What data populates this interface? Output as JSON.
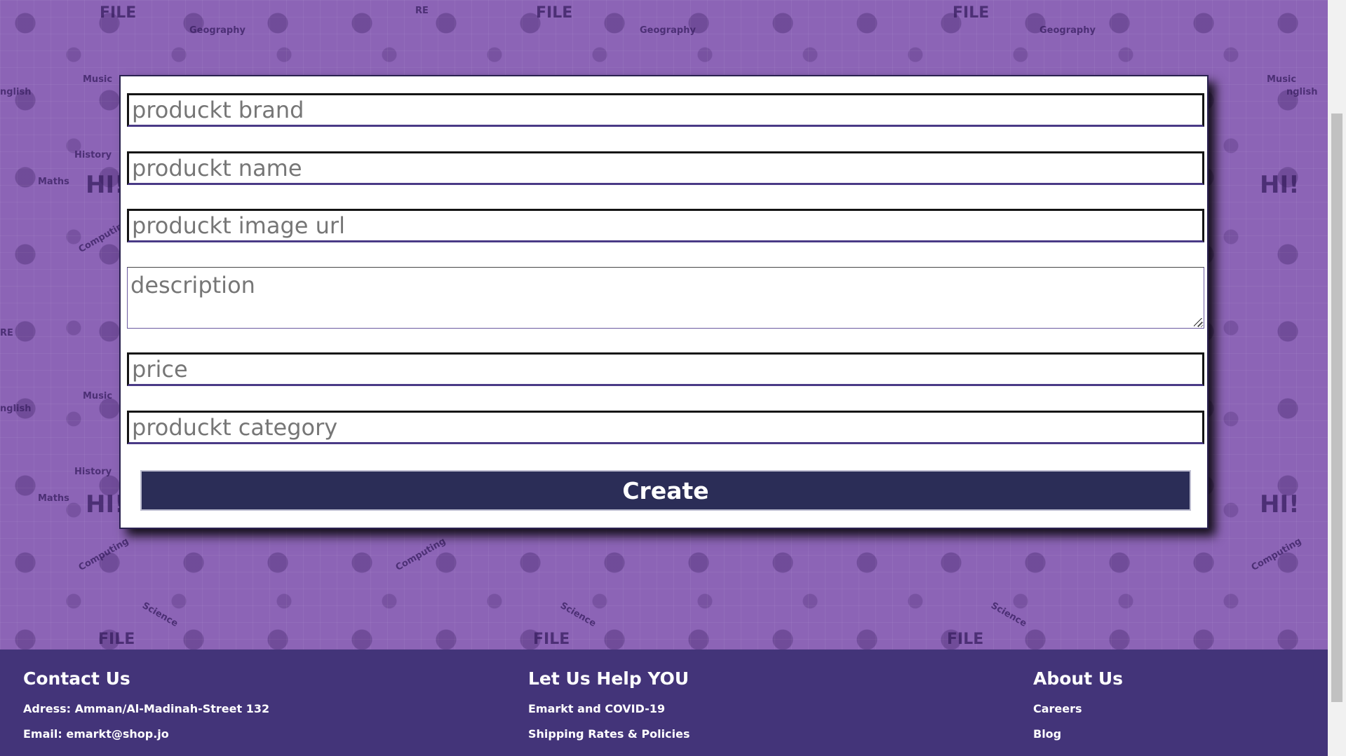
{
  "form": {
    "brand_placeholder": "produckt brand",
    "name_placeholder": "produckt name",
    "image_placeholder": "produckt image url",
    "description_placeholder": "description",
    "price_placeholder": "price",
    "category_placeholder": "produckt category",
    "create_label": "Create"
  },
  "background_doodles": {
    "file": "FILE",
    "re": "RE",
    "geography": "Geography",
    "music": "Music",
    "english": "nglish",
    "history": "History",
    "maths": "Maths",
    "hi": "HI!",
    "computing": "Computing",
    "science": "Science"
  },
  "footer": {
    "contact": {
      "title": "Contact Us",
      "address": "Adress: Amman/Al-Madinah-Street 132",
      "email": "Email: emarkt@shop.jo"
    },
    "help": {
      "title": "Let Us Help YOU",
      "covid": "Emarkt and COVID-19",
      "shipping": "Shipping Rates & Policies"
    },
    "about": {
      "title": "About Us",
      "careers": "Careers",
      "blog": "Blog"
    }
  },
  "colors": {
    "background": "#8c64b6",
    "footer": "#433479",
    "button": "#2b2d57"
  }
}
